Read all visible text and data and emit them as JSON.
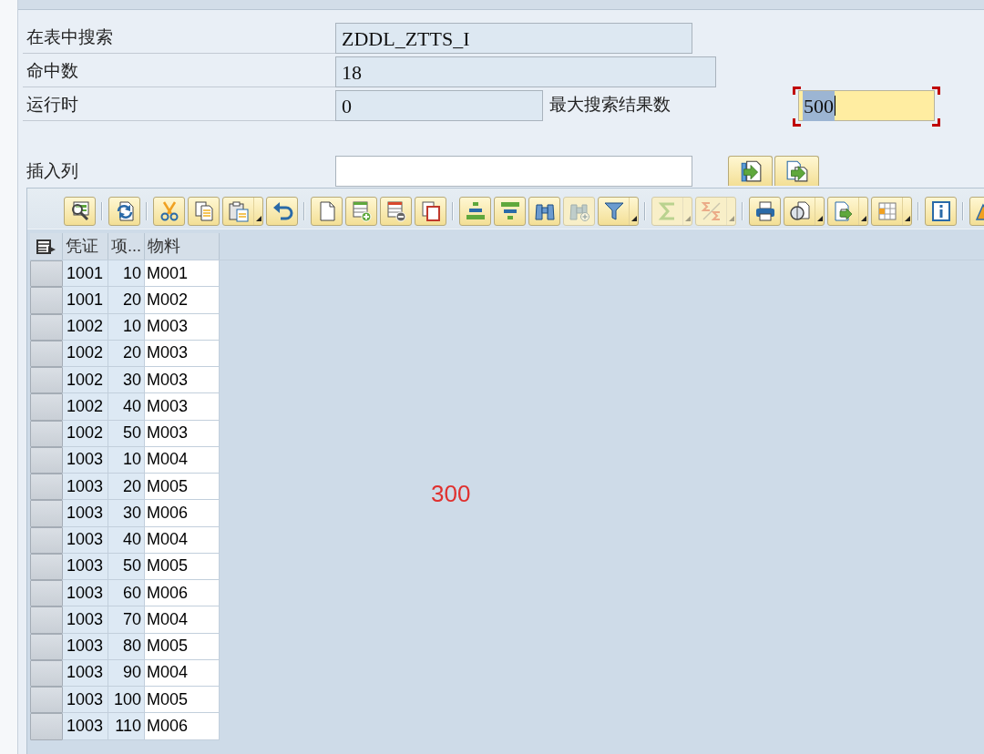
{
  "form": {
    "search_table": {
      "label": "在表中搜索",
      "value": "ZDDL_ZTTS_I",
      "readonly": true
    },
    "hit_count": {
      "label": "命中数",
      "value": "18",
      "readonly": true
    },
    "runtime": {
      "label": "运行时",
      "value": "0",
      "readonly": true
    },
    "max_results": {
      "label": "最大搜索结果数",
      "value": "500",
      "readonly": false,
      "focused": true
    },
    "insert_column": {
      "label": "插入列",
      "readonly": false
    }
  },
  "toolbar": [
    {
      "buttons": [
        {
          "kind": "details",
          "disabled": false
        }
      ]
    },
    {
      "buttons": [
        {
          "kind": "refresh",
          "disabled": false
        }
      ]
    },
    {
      "buttons": [
        {
          "kind": "cut",
          "disabled": false
        },
        {
          "kind": "copy",
          "disabled": false
        },
        {
          "kind": "paste",
          "disabled": false
        },
        {
          "kind": "undo",
          "disabled": false
        }
      ]
    },
    {
      "buttons": [
        {
          "kind": "new",
          "disabled": false
        },
        {
          "kind": "insert",
          "disabled": false
        },
        {
          "kind": "delete",
          "disabled": false
        },
        {
          "kind": "duplicate",
          "disabled": false
        }
      ]
    },
    {
      "buttons": [
        {
          "kind": "sortup",
          "disabled": false
        },
        {
          "kind": "sortdown",
          "disabled": false
        },
        {
          "kind": "find",
          "disabled": false
        },
        {
          "kind": "findnext",
          "disabled": true
        },
        {
          "kind": "filter",
          "disabled": false
        }
      ]
    },
    {
      "buttons": [
        {
          "kind": "sum",
          "disabled": true
        },
        {
          "kind": "subtotal",
          "disabled": true
        }
      ]
    },
    {
      "buttons": [
        {
          "kind": "print",
          "disabled": false
        },
        {
          "kind": "views",
          "disabled": false
        },
        {
          "kind": "export",
          "disabled": false
        },
        {
          "kind": "layout",
          "disabled": false
        }
      ]
    },
    {
      "buttons": [
        {
          "kind": "info",
          "disabled": false
        }
      ]
    },
    {
      "buttons": [
        {
          "kind": "graphic",
          "disabled": false
        }
      ]
    }
  ],
  "table": {
    "columns": [
      "凭证",
      "项...",
      "物料"
    ],
    "rows": [
      {
        "cells": [
          "1001",
          "10",
          "M001"
        ],
        "selected": false
      },
      {
        "cells": [
          "1001",
          "20",
          "M002"
        ],
        "selected": false
      },
      {
        "cells": [
          "1002",
          "10",
          "M003"
        ],
        "selected": false
      },
      {
        "cells": [
          "1002",
          "20",
          "M003"
        ],
        "selected": false
      },
      {
        "cells": [
          "1002",
          "30",
          "M003"
        ],
        "selected": false
      },
      {
        "cells": [
          "1002",
          "40",
          "M003"
        ],
        "selected": false
      },
      {
        "cells": [
          "1002",
          "50",
          "M003"
        ],
        "selected": false
      },
      {
        "cells": [
          "1003",
          "10",
          "M004"
        ],
        "selected": false
      },
      {
        "cells": [
          "1003",
          "20",
          "M005"
        ],
        "selected": false
      },
      {
        "cells": [
          "1003",
          "30",
          "M006"
        ],
        "selected": false
      },
      {
        "cells": [
          "1003",
          "40",
          "M004"
        ],
        "selected": false
      },
      {
        "cells": [
          "1003",
          "50",
          "M005"
        ],
        "selected": false
      },
      {
        "cells": [
          "1003",
          "60",
          "M006"
        ],
        "selected": false
      },
      {
        "cells": [
          "1003",
          "70",
          "M004"
        ],
        "selected": false
      },
      {
        "cells": [
          "1003",
          "80",
          "M005"
        ],
        "selected": false
      },
      {
        "cells": [
          "1003",
          "90",
          "M004"
        ],
        "selected": false
      },
      {
        "cells": [
          "1003",
          "100",
          "M005"
        ],
        "selected": false
      },
      {
        "cells": [
          "1003",
          "110",
          "M006"
        ],
        "selected": false
      }
    ]
  },
  "annotation": "300"
}
